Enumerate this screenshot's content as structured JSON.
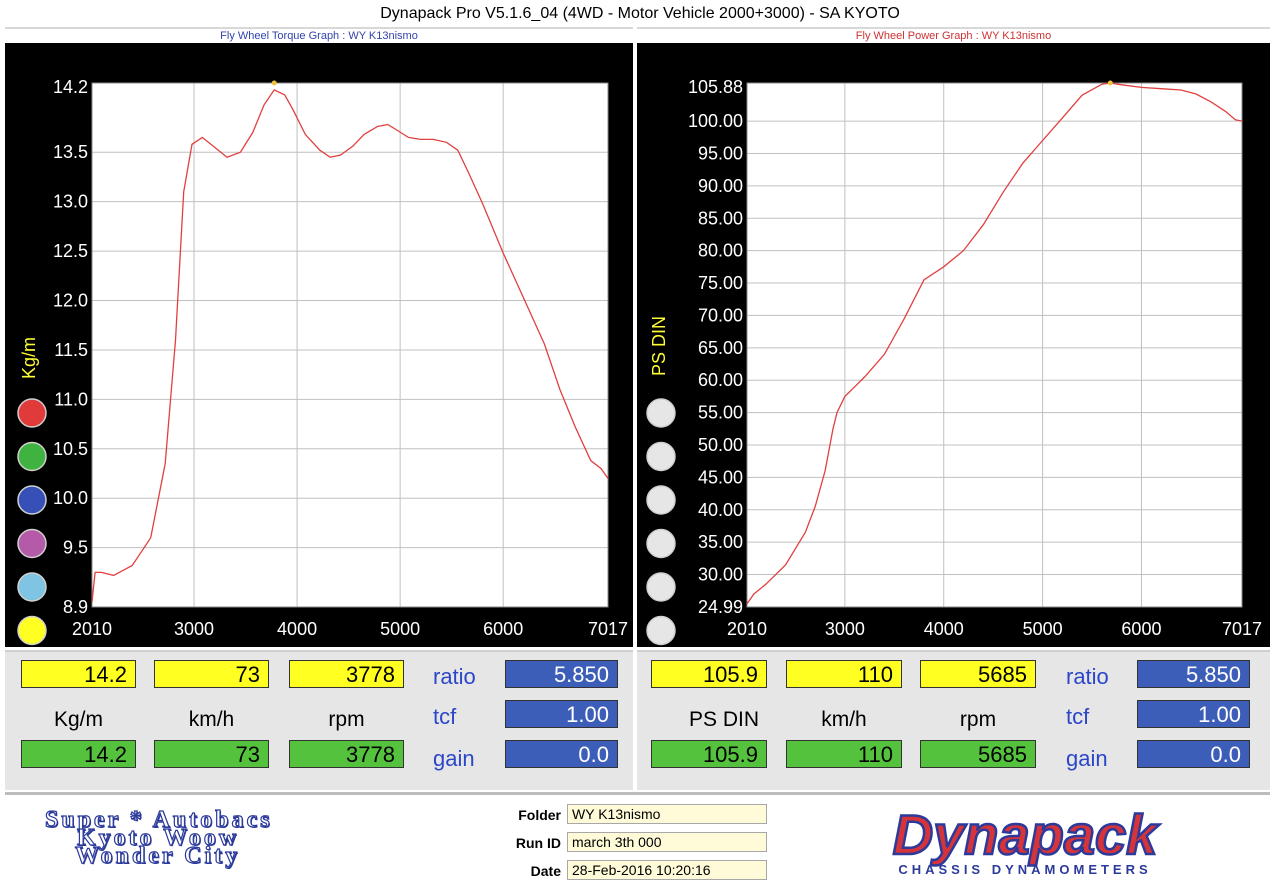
{
  "window": {
    "title": "Dynapack Pro V5.1.6_04 (4WD - Motor Vehicle 2000+3000) - SA KYOTO"
  },
  "colors": {
    "curve": "#e04040",
    "grid": "#c0c0c0",
    "plot_bg": "#ffffff",
    "frame": "#000000",
    "tick_text": "#ffffff",
    "axis_label": "#ffff33",
    "marker": "#f0c040"
  },
  "chart_data": [
    {
      "type": "line",
      "title": "Fly Wheel Torque Graph : WY K13nismo",
      "xlabel": "rpm",
      "ylabel": "Kg/m",
      "xlim": [
        2010,
        7017
      ],
      "ylim": [
        8.9,
        14.2
      ],
      "xticks": [
        "2010",
        "3000",
        "4000",
        "5000",
        "6000",
        "7017"
      ],
      "yticks": [
        "14.2",
        "13.5",
        "13.0",
        "12.5",
        "12.0",
        "11.5",
        "11.0",
        "10.5",
        "10.0",
        "9.5",
        "8.9"
      ],
      "grid": true,
      "series": [
        {
          "x": [
            2010,
            2040,
            2100,
            2220,
            2400,
            2580,
            2720,
            2820,
            2900,
            2980,
            3080,
            3200,
            3320,
            3450,
            3570,
            3680,
            3778,
            3880,
            3960,
            4080,
            4220,
            4320,
            4420,
            4540,
            4650,
            4780,
            4880,
            4960,
            5080,
            5200,
            5320,
            5450,
            5560,
            5660,
            5800,
            6000,
            6200,
            6400,
            6550,
            6700,
            6850,
            6950,
            7017
          ],
          "y": [
            8.95,
            9.25,
            9.25,
            9.22,
            9.32,
            9.6,
            10.35,
            11.6,
            13.1,
            13.58,
            13.65,
            13.55,
            13.45,
            13.5,
            13.7,
            13.98,
            14.13,
            14.08,
            13.93,
            13.68,
            13.52,
            13.45,
            13.47,
            13.56,
            13.68,
            13.76,
            13.78,
            13.73,
            13.65,
            13.63,
            13.63,
            13.6,
            13.52,
            13.3,
            12.98,
            12.48,
            12.02,
            11.56,
            11.1,
            10.72,
            10.38,
            10.3,
            10.2
          ]
        }
      ],
      "max_marker": {
        "x": 3778,
        "y": 14.2
      }
    },
    {
      "type": "line",
      "title": "Fly Wheel Power Graph : WY K13nismo",
      "xlabel": "rpm",
      "ylabel": "PS DIN",
      "xlim": [
        2010,
        7017
      ],
      "ylim": [
        24.99,
        105.88
      ],
      "xticks": [
        "2010",
        "3000",
        "4000",
        "5000",
        "6000",
        "7017"
      ],
      "yticks": [
        "105.88",
        "100.00",
        "95.00",
        "90.00",
        "85.00",
        "80.00",
        "75.00",
        "70.00",
        "65.00",
        "60.00",
        "55.00",
        "50.00",
        "45.00",
        "40.00",
        "35.00",
        "30.00",
        "24.99"
      ],
      "grid": true,
      "series": [
        {
          "x": [
            2010,
            2080,
            2200,
            2400,
            2600,
            2700,
            2800,
            2880,
            2920,
            3000,
            3100,
            3200,
            3400,
            3600,
            3800,
            4000,
            4200,
            4400,
            4600,
            4800,
            5000,
            5200,
            5400,
            5600,
            5685,
            5800,
            6000,
            6200,
            6400,
            6550,
            6700,
            6850,
            6950,
            7017
          ],
          "y": [
            25.5,
            27.0,
            28.5,
            31.5,
            36.5,
            40.5,
            46.0,
            52.5,
            55.0,
            57.5,
            59.0,
            60.5,
            64.0,
            69.5,
            75.5,
            77.5,
            80.0,
            84.0,
            89.0,
            93.5,
            97.0,
            100.5,
            104.0,
            105.7,
            105.88,
            105.6,
            105.2,
            105.0,
            104.8,
            104.2,
            103.0,
            101.5,
            100.2,
            100.0
          ]
        }
      ],
      "max_marker": {
        "x": 5685,
        "y": 105.88
      }
    }
  ],
  "left_panel": {
    "peak": [
      "14.2",
      "73",
      "3778"
    ],
    "units": [
      "Kg/m",
      "km/h",
      "rpm"
    ],
    "current": [
      "14.2",
      "73",
      "3778"
    ],
    "labels": {
      "ratio": "ratio",
      "tcf": "tcf",
      "gain": "gain"
    },
    "values": {
      "ratio": "5.850",
      "tcf": "1.00",
      "gain": "0.0"
    },
    "circle_colors": [
      "#e03a3a",
      "#3fb23f",
      "#3650b8",
      "#b45aa8",
      "#7fc4e2",
      "#ffff22"
    ]
  },
  "right_panel": {
    "peak": [
      "105.9",
      "110",
      "5685"
    ],
    "units": [
      "PS DIN",
      "km/h",
      "rpm"
    ],
    "current": [
      "105.9",
      "110",
      "5685"
    ],
    "labels": {
      "ratio": "ratio",
      "tcf": "tcf",
      "gain": "gain"
    },
    "values": {
      "ratio": "5.850",
      "tcf": "1.00",
      "gain": "0.0"
    },
    "circle_colors": [
      "#e6e6e6",
      "#e6e6e6",
      "#e6e6e6",
      "#e6e6e6",
      "#e6e6e6",
      "#e6e6e6"
    ]
  },
  "footer": {
    "shop_lines": [
      "Super * Autobacs",
      "Kyoto Woow",
      "Wonder City"
    ],
    "fields": [
      {
        "label": "Folder",
        "value": "WY K13nismo"
      },
      {
        "label": "Run ID",
        "value": "march 3th 000"
      },
      {
        "label": "Date",
        "value": "28-Feb-2016 10:20:16"
      }
    ],
    "logo_text": "Dynapack",
    "logo_sub": "CHASSIS  DYNAMOMETERS"
  }
}
